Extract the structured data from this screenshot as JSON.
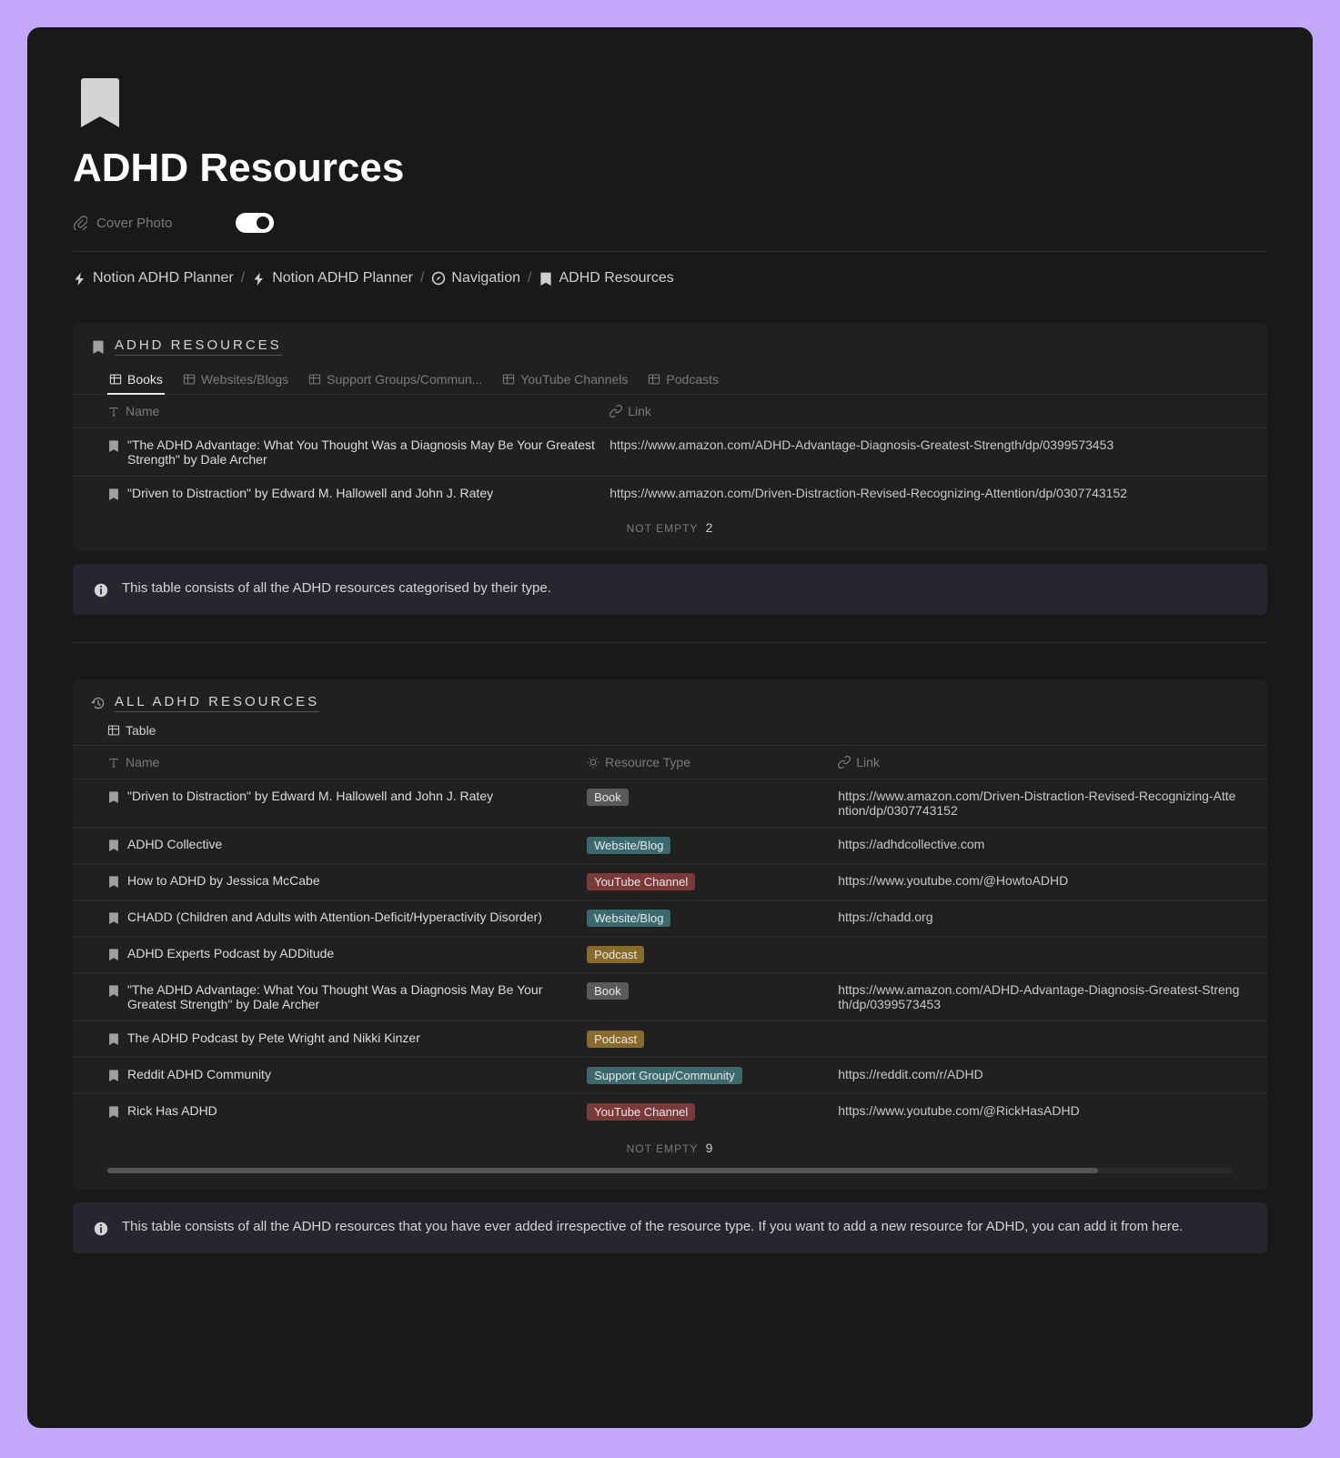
{
  "page": {
    "title": "ADHD Resources",
    "cover_label": "Cover Photo"
  },
  "breadcrumb": {
    "items": [
      {
        "label": "Notion ADHD Planner",
        "icon": "bolt"
      },
      {
        "label": "Notion ADHD Planner",
        "icon": "bolt"
      },
      {
        "label": "Navigation",
        "icon": "compass"
      },
      {
        "label": "ADHD Resources",
        "icon": "bookmark"
      }
    ]
  },
  "section1": {
    "title": "ADHD RESOURCES",
    "tabs": [
      "Books",
      "Websites/Blogs",
      "Support Groups/Commun...",
      "YouTube Channels",
      "Podcasts"
    ],
    "columns": {
      "name": "Name",
      "link": "Link"
    },
    "rows": [
      {
        "name": "\"The ADHD Advantage: What You Thought Was a Diagnosis May Be Your Greatest Strength\" by Dale Archer",
        "link": "https://www.amazon.com/ADHD-Advantage-Diagnosis-Greatest-Strength/dp/0399573453"
      },
      {
        "name": "\"Driven to Distraction\" by Edward M. Hallowell and John J. Ratey",
        "link": "https://www.amazon.com/Driven-Distraction-Revised-Recognizing-Attention/dp/0307743152"
      }
    ],
    "summary_label": "NOT EMPTY",
    "summary_count": "2"
  },
  "callout1": "This table consists of all the ADHD resources categorised by their type.",
  "section2": {
    "title": "ALL ADHD RESOURCES",
    "view_label": "Table",
    "columns": {
      "name": "Name",
      "type": "Resource Type",
      "link": "Link"
    },
    "rows": [
      {
        "name": "\"Driven to Distraction\" by Edward M. Hallowell and John J. Ratey",
        "type": "Book",
        "tag": "book",
        "link": "https://www.amazon.com/Driven-Distraction-Revised-Recognizing-Attention/dp/0307743152"
      },
      {
        "name": "ADHD Collective",
        "type": "Website/Blog",
        "tag": "website",
        "link": "https://adhdcollective.com"
      },
      {
        "name": "How to ADHD by Jessica McCabe",
        "type": "YouTube Channel",
        "tag": "youtube",
        "link": "https://www.youtube.com/@HowtoADHD"
      },
      {
        "name": "CHADD (Children and Adults with Attention-Deficit/Hyperactivity Disorder)",
        "type": "Website/Blog",
        "tag": "website",
        "link": "https://chadd.org"
      },
      {
        "name": "ADHD Experts Podcast by ADDitude",
        "type": "Podcast",
        "tag": "podcast",
        "link": ""
      },
      {
        "name": "\"The ADHD Advantage: What You Thought Was a Diagnosis May Be Your Greatest Strength\" by Dale Archer",
        "type": "Book",
        "tag": "book",
        "link": "https://www.amazon.com/ADHD-Advantage-Diagnosis-Greatest-Strength/dp/0399573453"
      },
      {
        "name": "The ADHD Podcast by Pete Wright and Nikki Kinzer",
        "type": "Podcast",
        "tag": "podcast",
        "link": ""
      },
      {
        "name": "Reddit ADHD Community",
        "type": "Support Group/Community",
        "tag": "support",
        "link": "https://reddit.com/r/ADHD"
      },
      {
        "name": "Rick Has ADHD",
        "type": "YouTube Channel",
        "tag": "youtube",
        "link": "https://www.youtube.com/@RickHasADHD"
      }
    ],
    "summary_label": "NOT EMPTY",
    "summary_count": "9"
  },
  "callout2": "This table consists of all the ADHD resources that you have ever added irrespective of the resource type. If you want to add a new resource for ADHD, you can add it from here."
}
